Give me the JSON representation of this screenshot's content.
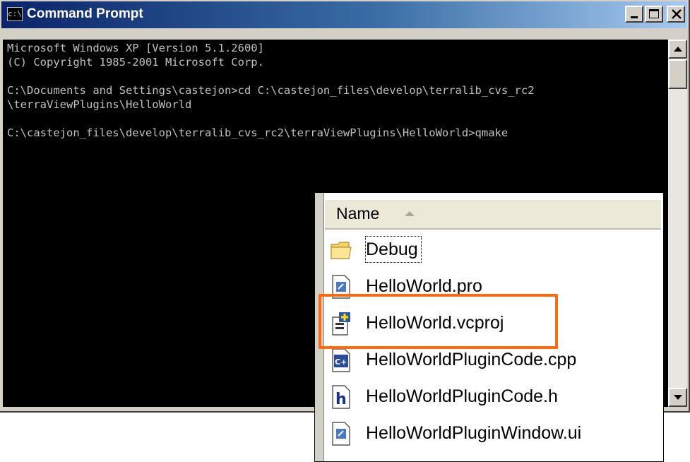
{
  "window": {
    "title": "Command Prompt",
    "icon": "console-icon",
    "icon_glyph": "c:\\"
  },
  "console": {
    "lines": [
      "Microsoft Windows XP [Version 5.1.2600]",
      "(C) Copyright 1985-2001 Microsoft Corp.",
      "",
      "C:\\Documents and Settings\\castejon>cd C:\\castejon_files\\develop\\terralib_cvs_rc2",
      "\\terraViewPlugins\\HelloWorld",
      "",
      "C:\\castejon_files\\develop\\terralib_cvs_rc2\\terraViewPlugins\\HelloWorld>qmake"
    ]
  },
  "explorer": {
    "column_header": "Name",
    "files": [
      {
        "name": "Debug",
        "icon": "folder-icon"
      },
      {
        "name": "HelloWorld.pro",
        "icon": "text-file-icon"
      },
      {
        "name": "HelloWorld.vcproj",
        "icon": "vcproj-file-icon"
      },
      {
        "name": "HelloWorldPluginCode.cpp",
        "icon": "cpp-file-icon"
      },
      {
        "name": "HelloWorldPluginCode.h",
        "icon": "h-file-icon"
      },
      {
        "name": "HelloWorldPluginWindow.ui",
        "icon": "ui-file-icon"
      }
    ]
  },
  "colors": {
    "titlebar_start": "#0a246a",
    "titlebar_end": "#a6caf0",
    "console_bg": "#000000",
    "console_text": "#c0c0c0",
    "highlight": "#ff6a13"
  }
}
